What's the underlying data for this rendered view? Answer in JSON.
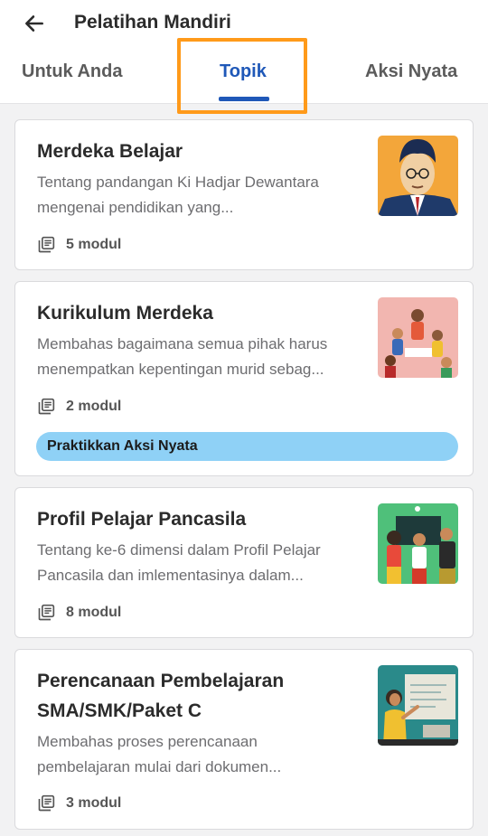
{
  "header": {
    "title": "Pelatihan Mandiri",
    "tabs": [
      {
        "label": "Untuk Anda",
        "active": false
      },
      {
        "label": "Topik",
        "active": true
      },
      {
        "label": "Aksi Nyata",
        "active": false
      }
    ],
    "accent_color": "#1f58b8",
    "highlight_color": "#ff9a1a"
  },
  "cards": [
    {
      "title": "Merdeka Belajar",
      "description": [
        "Tentang pandangan Ki Hadjar Dewantara",
        "mengenai pendidikan yang..."
      ],
      "modules": "5 modul"
    },
    {
      "title": "Kurikulum Merdeka",
      "description": [
        "Membahas bagaimana semua pihak harus",
        "menempatkan kepentingan murid sebag..."
      ],
      "modules": "2 modul",
      "action_label": "Praktikkan Aksi Nyata"
    },
    {
      "title": "Profil Pelajar Pancasila",
      "description": [
        "Tentang ke-6 dimensi dalam Profil Pelajar",
        "Pancasila dan imlementasinya dalam..."
      ],
      "modules": "8 modul"
    },
    {
      "title_lines": [
        "Perencanaan Pembelajaran",
        "SMA/SMK/Paket C"
      ],
      "description": [
        "Membahas proses perencanaan",
        "pembelajaran mulai dari dokumen..."
      ],
      "modules": "3 modul"
    }
  ]
}
